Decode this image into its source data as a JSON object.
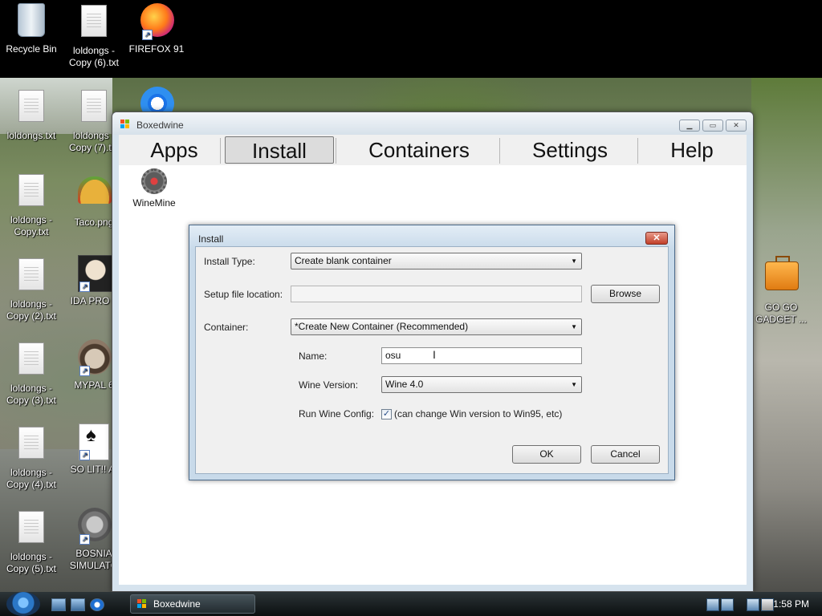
{
  "desktop": {
    "icons": [
      {
        "label": "Recycle Bin"
      },
      {
        "label": "loldongs - Copy (6).txt"
      },
      {
        "label": "FIREFOX 91"
      },
      {
        "label": "loldongs.txt"
      },
      {
        "label": "loldongs - Copy (7).txt"
      },
      {
        "label": "loldongs - Copy.txt"
      },
      {
        "label": "Taco.png"
      },
      {
        "label": "loldongs - Copy (2).txt"
      },
      {
        "label": "IDA PRO 6"
      },
      {
        "label": "loldongs - Copy (3).txt"
      },
      {
        "label": "MYPAL 6"
      },
      {
        "label": "loldongs - Copy (4).txt"
      },
      {
        "label": "SO LIT!! AI"
      },
      {
        "label": "loldongs - Copy (5).txt"
      },
      {
        "label": "BOSNIA SIMULATO"
      },
      {
        "label": "GO GO GADGET ..."
      }
    ]
  },
  "window": {
    "title": "Boxedwine",
    "tabs": [
      "Apps",
      "Install",
      "Containers",
      "Settings",
      "Help"
    ],
    "active_tab": "Install",
    "apps": [
      {
        "label": "WineMine"
      }
    ]
  },
  "dialog": {
    "title": "Install",
    "install_type_label": "Install Type:",
    "install_type_value": "Create blank container",
    "setup_file_label": "Setup file location:",
    "setup_file_value": "",
    "browse_label": "Browse",
    "container_label": "Container:",
    "container_value": "*Create New Container (Recommended)",
    "name_label": "Name:",
    "name_value": "osu",
    "wine_version_label": "Wine Version:",
    "wine_version_value": "Wine 4.0",
    "run_wine_config_label": "Run Wine Config:",
    "run_wine_config_checked": true,
    "run_wine_config_note": "(can change Win version to Win95, etc)",
    "ok_label": "OK",
    "cancel_label": "Cancel"
  },
  "taskbar": {
    "app_button": "Boxedwine",
    "clock": "1:58 PM"
  },
  "colors": {
    "dialog_frame": "#c8daea",
    "window_frame": "#d6e3ee",
    "taskbar": "#1a2124"
  }
}
